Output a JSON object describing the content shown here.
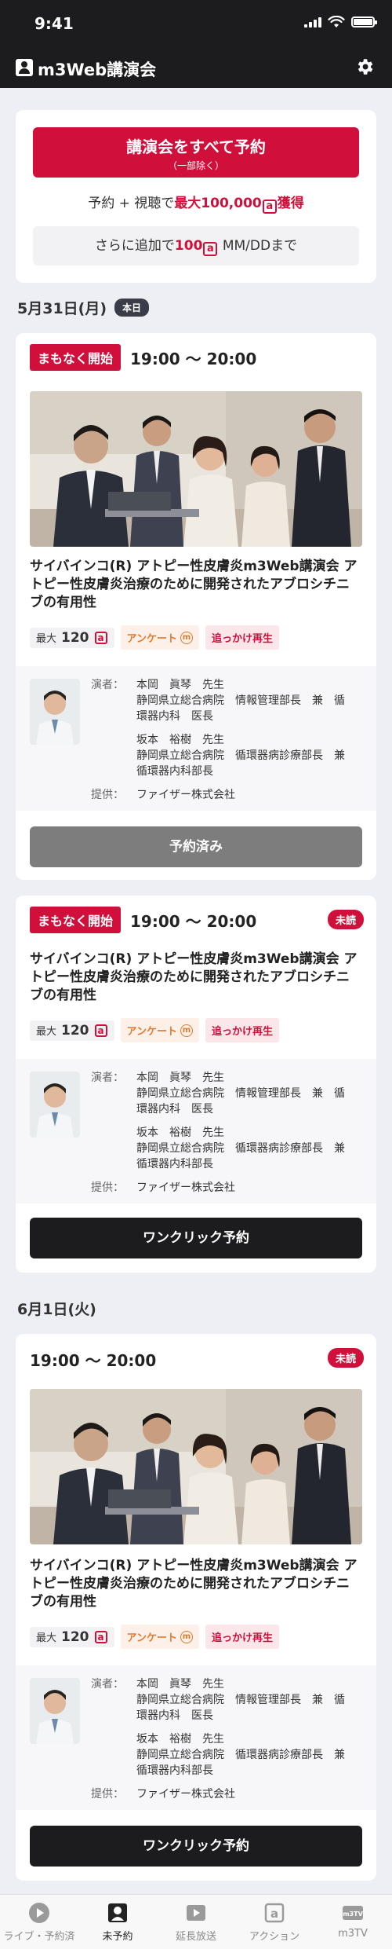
{
  "status_bar": {
    "time": "9:41"
  },
  "header": {
    "title": "m3Web講演会"
  },
  "promo": {
    "reserve_all_label": "講演会をすべて予約",
    "reserve_all_sub": "（一部除く）",
    "reward_prefix": "予約 + 視聴で",
    "reward_amount": "最大100,000",
    "reward_suffix": "獲得",
    "additional_prefix": "さらに追加で",
    "additional_amount": "100",
    "additional_suffix": "MM/DDまで",
    "point_symbol": "a"
  },
  "sections": [
    {
      "date": "5月31日(月)",
      "badge": "本日"
    },
    {
      "date": "6月1日(火)",
      "badge": ""
    }
  ],
  "events": [
    {
      "starting_badge": "まもなく開始",
      "time": "19:00 〜 20:00",
      "unread": "",
      "title": "サイバインコ(R) アトピー性皮膚炎m3Web講演会 アトピー性皮膚炎治療のために開発されたアブロシチニブの有用性",
      "max_label": "最大",
      "max_points": "120",
      "survey_label": "アンケート",
      "replay_label": "追っかけ再生",
      "speaker_label": "演者：",
      "speakers": [
        {
          "name": "本岡　眞琴　先生",
          "affiliation": "静岡県立総合病院　情報管理部長　兼　循環器内科　医長"
        },
        {
          "name": "坂本　裕樹　先生",
          "affiliation": "静岡県立総合病院　循環器病診療部長　兼　循環器内科部長"
        }
      ],
      "provider_label": "提供：",
      "provider": "ファイザー株式会社",
      "button": "予約済み"
    },
    {
      "starting_badge": "まもなく開始",
      "time": "19:00 〜 20:00",
      "unread": "未読",
      "title": "サイバインコ(R) アトピー性皮膚炎m3Web講演会 アトピー性皮膚炎治療のために開発されたアブロシチニブの有用性",
      "max_label": "最大",
      "max_points": "120",
      "survey_label": "アンケート",
      "replay_label": "追っかけ再生",
      "speaker_label": "演者：",
      "speakers": [
        {
          "name": "本岡　眞琴　先生",
          "affiliation": "静岡県立総合病院　情報管理部長　兼　循環器内科　医長"
        },
        {
          "name": "坂本　裕樹　先生",
          "affiliation": "静岡県立総合病院　循環器病診療部長　兼　循環器内科部長"
        }
      ],
      "provider_label": "提供：",
      "provider": "ファイザー株式会社",
      "button": "ワンクリック予約"
    },
    {
      "starting_badge": "",
      "time": "19:00 〜 20:00",
      "unread": "未読",
      "title": "サイバインコ(R) アトピー性皮膚炎m3Web講演会 アトピー性皮膚炎治療のために開発されたアブロシチニブの有用性",
      "max_label": "最大",
      "max_points": "120",
      "survey_label": "アンケート",
      "replay_label": "追っかけ再生",
      "speaker_label": "演者：",
      "speakers": [
        {
          "name": "本岡　眞琴　先生",
          "affiliation": "静岡県立総合病院　情報管理部長　兼　循環器内科　医長"
        },
        {
          "name": "坂本　裕樹　先生",
          "affiliation": "静岡県立総合病院　循環器病診療部長　兼　循環器内科部長"
        }
      ],
      "provider_label": "提供：",
      "provider": "ファイザー株式会社",
      "button": "ワンクリック予約"
    }
  ],
  "tabs": [
    {
      "label": "ライブ・予約済",
      "icon": "play-icon",
      "active": false
    },
    {
      "label": "未予約",
      "icon": "person-icon",
      "active": true
    },
    {
      "label": "延長放送",
      "icon": "video-play-icon",
      "active": false
    },
    {
      "label": "アクション",
      "icon": "action-point-icon",
      "active": false
    },
    {
      "label": "m3TV",
      "icon": "m3tv-icon",
      "active": false
    }
  ],
  "colors": {
    "accent": "#d0103a",
    "header_bg": "#1c1c1e",
    "survey": "#e07a2e",
    "page_bg": "#eeeff5"
  }
}
